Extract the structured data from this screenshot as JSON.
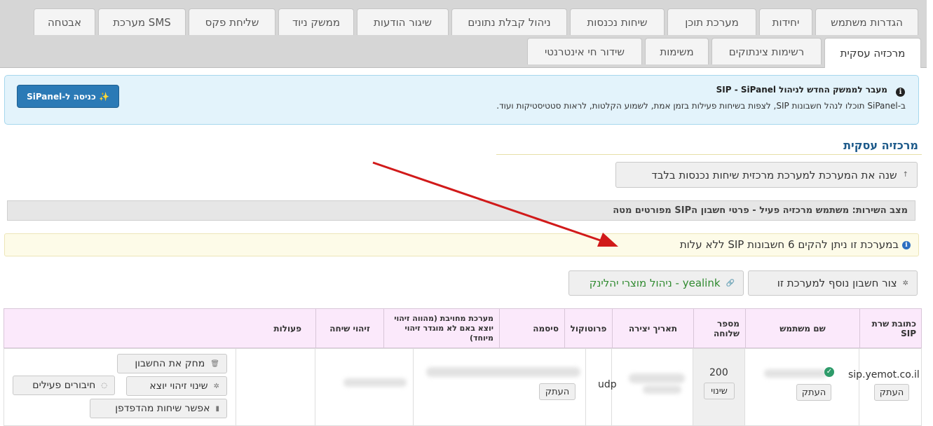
{
  "tabs_row1": [
    {
      "label": "הגדרות משתמש"
    },
    {
      "label": "יחידות"
    },
    {
      "label": "מערכת תוכן"
    },
    {
      "label": "שיחות נכנסות"
    },
    {
      "label": "ניהול קבלת נתונים"
    },
    {
      "label": "שיגור הודעות"
    },
    {
      "label": "ממשק ניוד"
    },
    {
      "label": "שליחת פקס"
    },
    {
      "label": "מערכת SMS"
    },
    {
      "label": "אבטחה"
    }
  ],
  "tabs_row2": [
    {
      "label": "מרכזיה עסקית",
      "active": true
    },
    {
      "label": "רשימות צינתוקים"
    },
    {
      "label": "משימות"
    },
    {
      "label": "שידור חי אינטרנטי"
    }
  ],
  "banner": {
    "title": "מעבר לממשק החדש לניהול SIP - SiPanel",
    "text": "ב-SiPanel תוכלו לנהל חשבונות SIP, לצפות בשיחות פעילות בזמן אמת, לשמוע הקלטות, לראות סטטיסטיקות ועוד.",
    "button_label": "✨ כניסה ל-SiPanel"
  },
  "section_title": "מרכזיה עסקית",
  "switch_button_label": "שנה את המערכת למערכת מרכזית שיחות נכנסות בלבד",
  "status_text": "מצב השירות: משתמש מרכזיה פעיל - פרטי חשבון הSIP מפורטים מטה",
  "notice_text": "במערכת זו ניתן להקים 6 חשבונות SIP ללא עלות",
  "create_account_label": "צור חשבון נוסף למערכת זו",
  "yealink_label": "ניהול מוצרי יהלינק - yealink",
  "table": {
    "headers": {
      "server": "כתובת שרת SIP",
      "username": "שם משתמש",
      "extension": "מספר שלוחה",
      "created": "תאריך יצירה",
      "protocol": "פרוטוקול",
      "password": "סיסמה",
      "billed_system": "מערכת מחויבת (מהווה זיהוי יוצא באם לא מוגדר זיהוי מיוחד)",
      "caller_id": "זיהוי שיחה",
      "actions": "פעולות"
    },
    "row": {
      "server": "sip.yemot.co.il",
      "extension": "200",
      "protocol": "udp",
      "copy_label": "העתק",
      "change_label": "שינוי",
      "delete_label": "מחק את החשבון",
      "change_callerid_label": "שינוי זיהוי יוצא",
      "active_connections_label": "חיבורים פעילים",
      "browser_calls_label": "אפשר שיחות מהדפדפן"
    }
  },
  "colors": {
    "accent": "#2b7ab6",
    "header_bg": "#fbe9fb",
    "title": "#1d5a8a",
    "arrow": "#d11a1a"
  }
}
